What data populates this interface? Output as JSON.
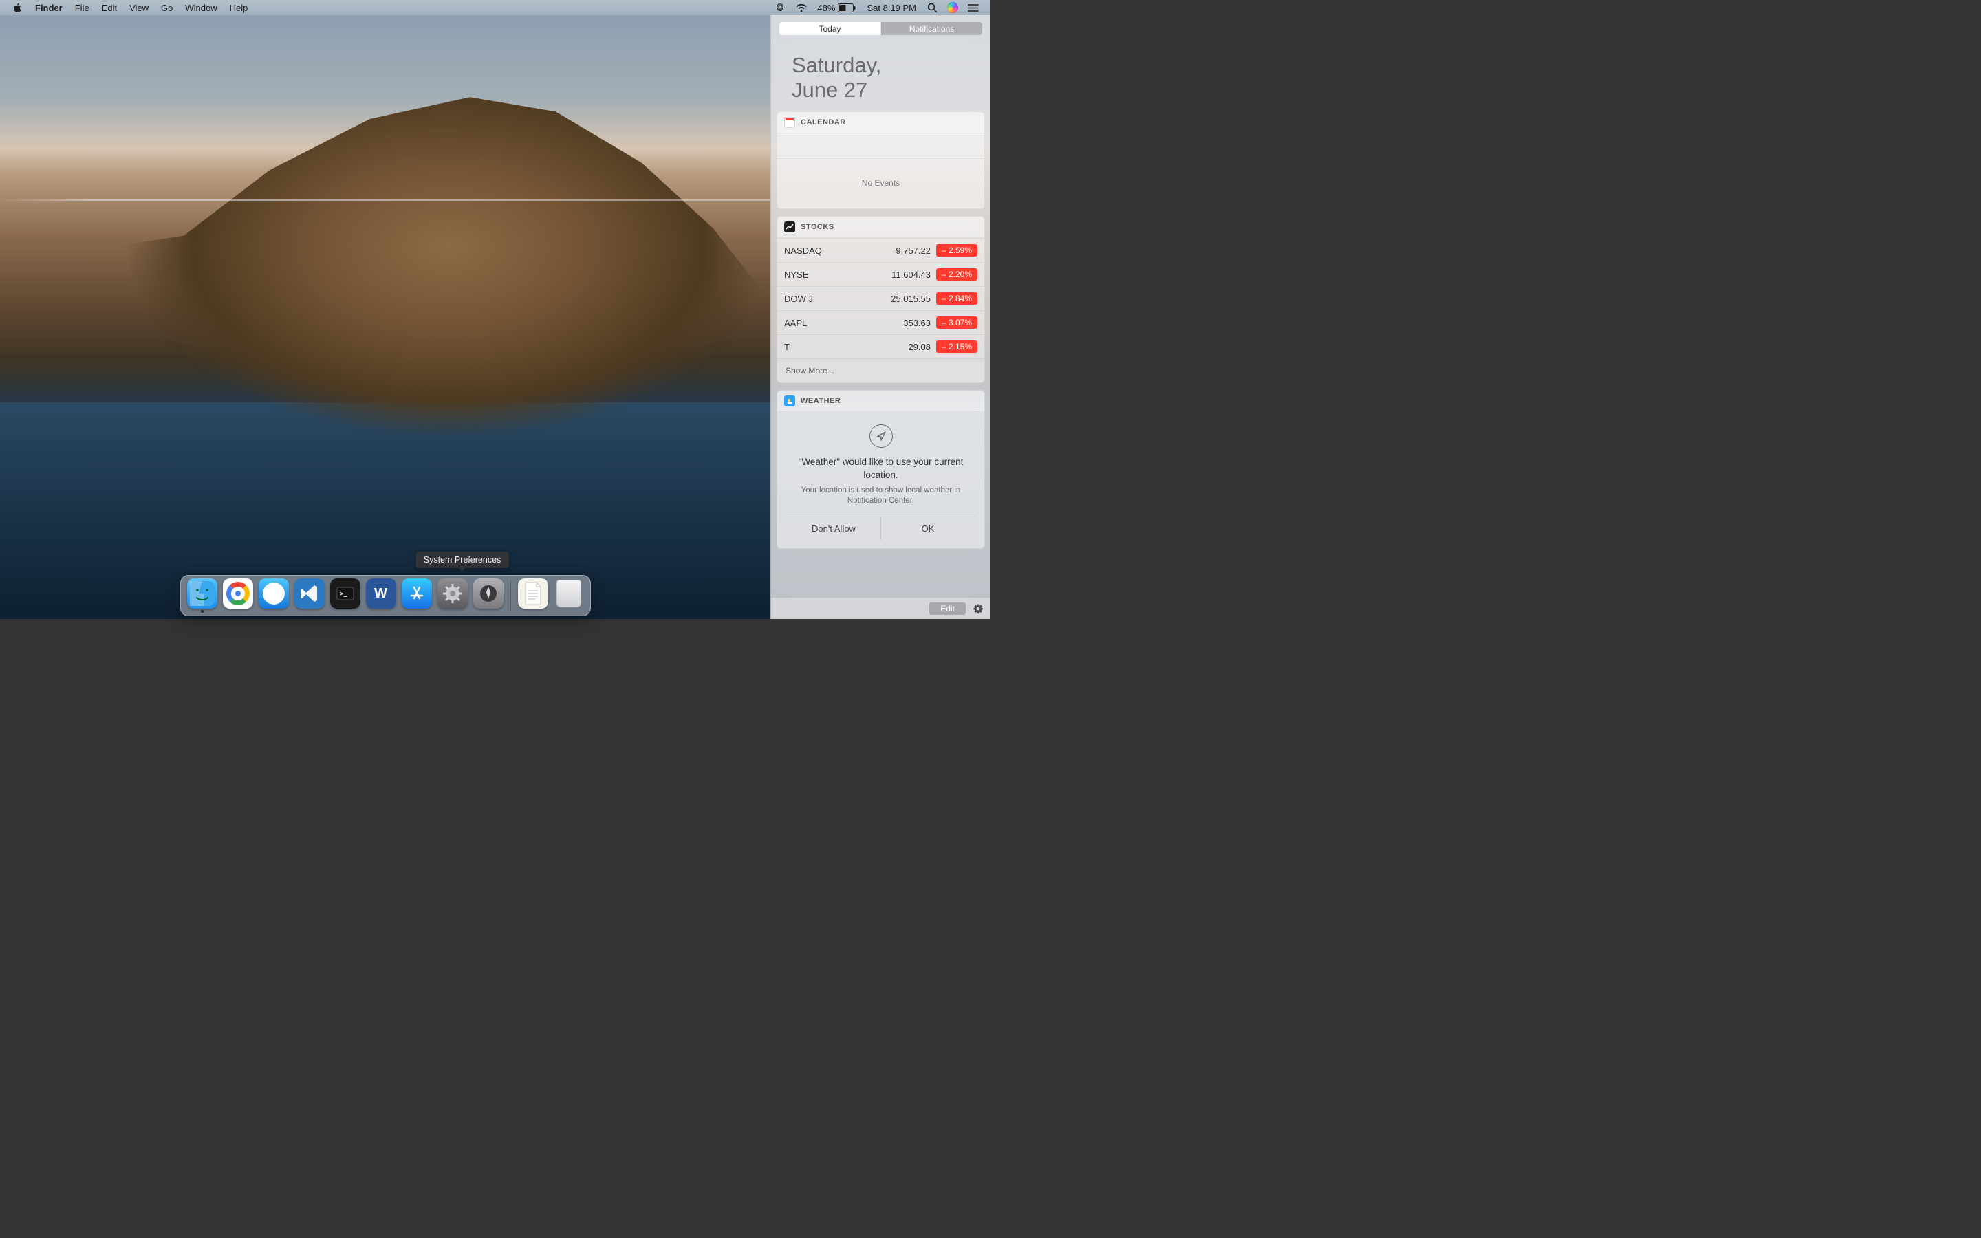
{
  "menubar": {
    "app": "Finder",
    "items": [
      "File",
      "Edit",
      "View",
      "Go",
      "Window",
      "Help"
    ],
    "battery_pct": "48%",
    "clock": "Sat 8:19 PM"
  },
  "nc": {
    "tabs": {
      "today": "Today",
      "notifications": "Notifications"
    },
    "date": {
      "line1": "Saturday,",
      "line2": "June 27"
    },
    "calendar": {
      "title": "CALENDAR",
      "no_events": "No Events"
    },
    "stocks": {
      "title": "STOCKS",
      "rows": [
        {
          "sym": "NASDAQ",
          "price": "9,757.22",
          "chg": "– 2.59%"
        },
        {
          "sym": "NYSE",
          "price": "11,604.43",
          "chg": "– 2.20%"
        },
        {
          "sym": "DOW J",
          "price": "25,015.55",
          "chg": "– 2.84%"
        },
        {
          "sym": "AAPL",
          "price": "353.63",
          "chg": "– 3.07%"
        },
        {
          "sym": "T",
          "price": "29.08",
          "chg": "– 2.15%"
        }
      ],
      "show_more": "Show More..."
    },
    "weather": {
      "title": "WEATHER",
      "prompt_title": "\"Weather\" would like to use your current location.",
      "prompt_sub": "Your location is used to show local weather in Notification Center.",
      "deny": "Don't Allow",
      "ok": "OK"
    },
    "edit_label": "Edit"
  },
  "dock": {
    "tooltip": "System Preferences",
    "items": [
      {
        "name": "finder",
        "label": "Finder",
        "running": true
      },
      {
        "name": "chrome",
        "label": "Google Chrome",
        "running": false
      },
      {
        "name": "safari",
        "label": "Safari",
        "running": false
      },
      {
        "name": "vscode",
        "label": "Visual Studio Code",
        "running": false
      },
      {
        "name": "terminal",
        "label": "Terminal",
        "running": false
      },
      {
        "name": "word",
        "label": "Microsoft Word",
        "running": false
      },
      {
        "name": "appstore",
        "label": "App Store",
        "running": false
      },
      {
        "name": "sysprefs",
        "label": "System Preferences",
        "running": false
      },
      {
        "name": "launchpad",
        "label": "Launchpad",
        "running": false
      }
    ],
    "right_items": [
      {
        "name": "textedit",
        "label": "TextEdit document"
      },
      {
        "name": "trash",
        "label": "Trash"
      }
    ]
  }
}
